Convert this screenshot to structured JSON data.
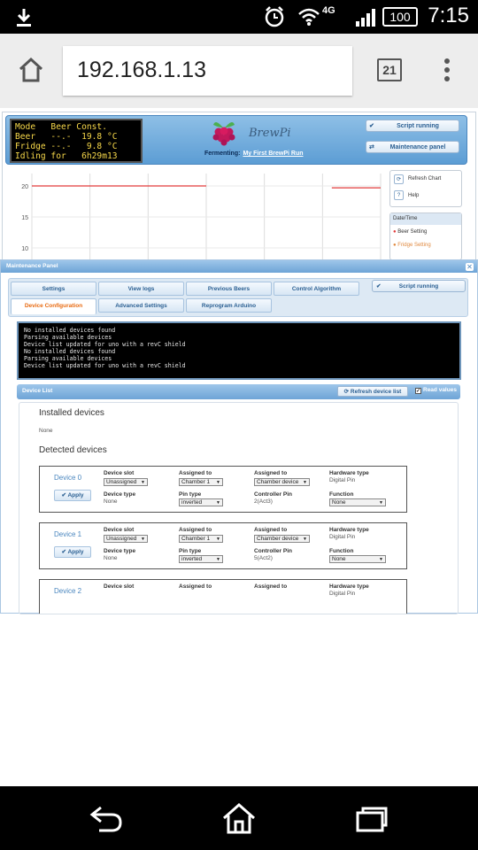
{
  "status_bar": {
    "time": "7:15",
    "battery": "100",
    "network": "4G",
    "icons": [
      "download-icon",
      "alarm-icon",
      "wifi-icon",
      "signal-icon",
      "battery-icon"
    ]
  },
  "browser": {
    "url": "192.168.1.13",
    "tab_count": "21"
  },
  "header": {
    "lcd_lines": [
      "Mode   Beer Const.",
      "Beer   --.-  19.8 °C",
      "Fridge --.-   9.8 °C",
      "Idling for   6h29m13"
    ],
    "logo_text": "BrewPi",
    "fermenting_label": "Fermenting:",
    "fermenting_name": "My First BrewPi Run",
    "script_running": "Script running",
    "maintenance_panel": "Maintenance panel"
  },
  "chart": {
    "refresh_chart": "Refresh Chart",
    "help": "Help",
    "legend_title": "Date/Time",
    "legend_items": [
      "Beer Setting",
      "Fridge Setting"
    ]
  },
  "chart_data": {
    "type": "line",
    "ylim": [
      8,
      22
    ],
    "yticks": [
      "20",
      "15",
      "10"
    ],
    "series": [
      {
        "name": "Beer Setting",
        "color": "#e23b3b",
        "segments": [
          [
            [
              0,
              20
            ],
            [
              0.5,
              20
            ]
          ],
          [
            [
              0.86,
              19.7
            ],
            [
              1.0,
              19.7
            ]
          ]
        ]
      }
    ]
  },
  "panel": {
    "title": "Maintenance Panel",
    "tabs_row1": [
      "Settings",
      "View logs",
      "Previous Beers",
      "Control Algorithm"
    ],
    "tabs_row2": [
      "Device Configuration",
      "Advanced Settings",
      "Reprogram Arduino"
    ],
    "script_running": "Script running",
    "console_lines": [
      "No installed devices found",
      "Parsing available devices",
      "Device list updated for uno with a revC shield",
      "No installed devices found",
      "Parsing available devices",
      "Device list updated for uno with a revC shield"
    ],
    "device_list_label": "Device List",
    "refresh_device_list": "Refresh device list",
    "read_values": "Read values",
    "installed_heading": "Installed devices",
    "installed_none": "None",
    "detected_heading": "Detected devices",
    "apply_label": "Apply",
    "labels": {
      "device_slot": "Device slot",
      "assigned_to": "Assigned to",
      "hardware_type": "Hardware type",
      "device_type": "Device type",
      "pin_type": "Pin type",
      "controller_pin": "Controller Pin",
      "function": "Function"
    },
    "devices": [
      {
        "name": "Device 0",
        "slot": "Unassigned",
        "chamber": "Chamber 1",
        "assigned": "Chamber device",
        "hardware": "Digital Pin",
        "device_type": "None",
        "pin_type": "inverted",
        "controller_pin": "2(Act3)",
        "function": "None"
      },
      {
        "name": "Device 1",
        "slot": "Unassigned",
        "chamber": "Chamber 1",
        "assigned": "Chamber device",
        "hardware": "Digital Pin",
        "device_type": "None",
        "pin_type": "inverted",
        "controller_pin": "5(Act2)",
        "function": "None"
      },
      {
        "name": "Device 2",
        "slot": "",
        "chamber": "",
        "assigned": "",
        "hardware": "Digital Pin",
        "device_type": "",
        "pin_type": "",
        "controller_pin": "",
        "function": ""
      }
    ]
  },
  "nav": {
    "icons": [
      "back-icon",
      "home-icon",
      "recents-icon"
    ]
  }
}
